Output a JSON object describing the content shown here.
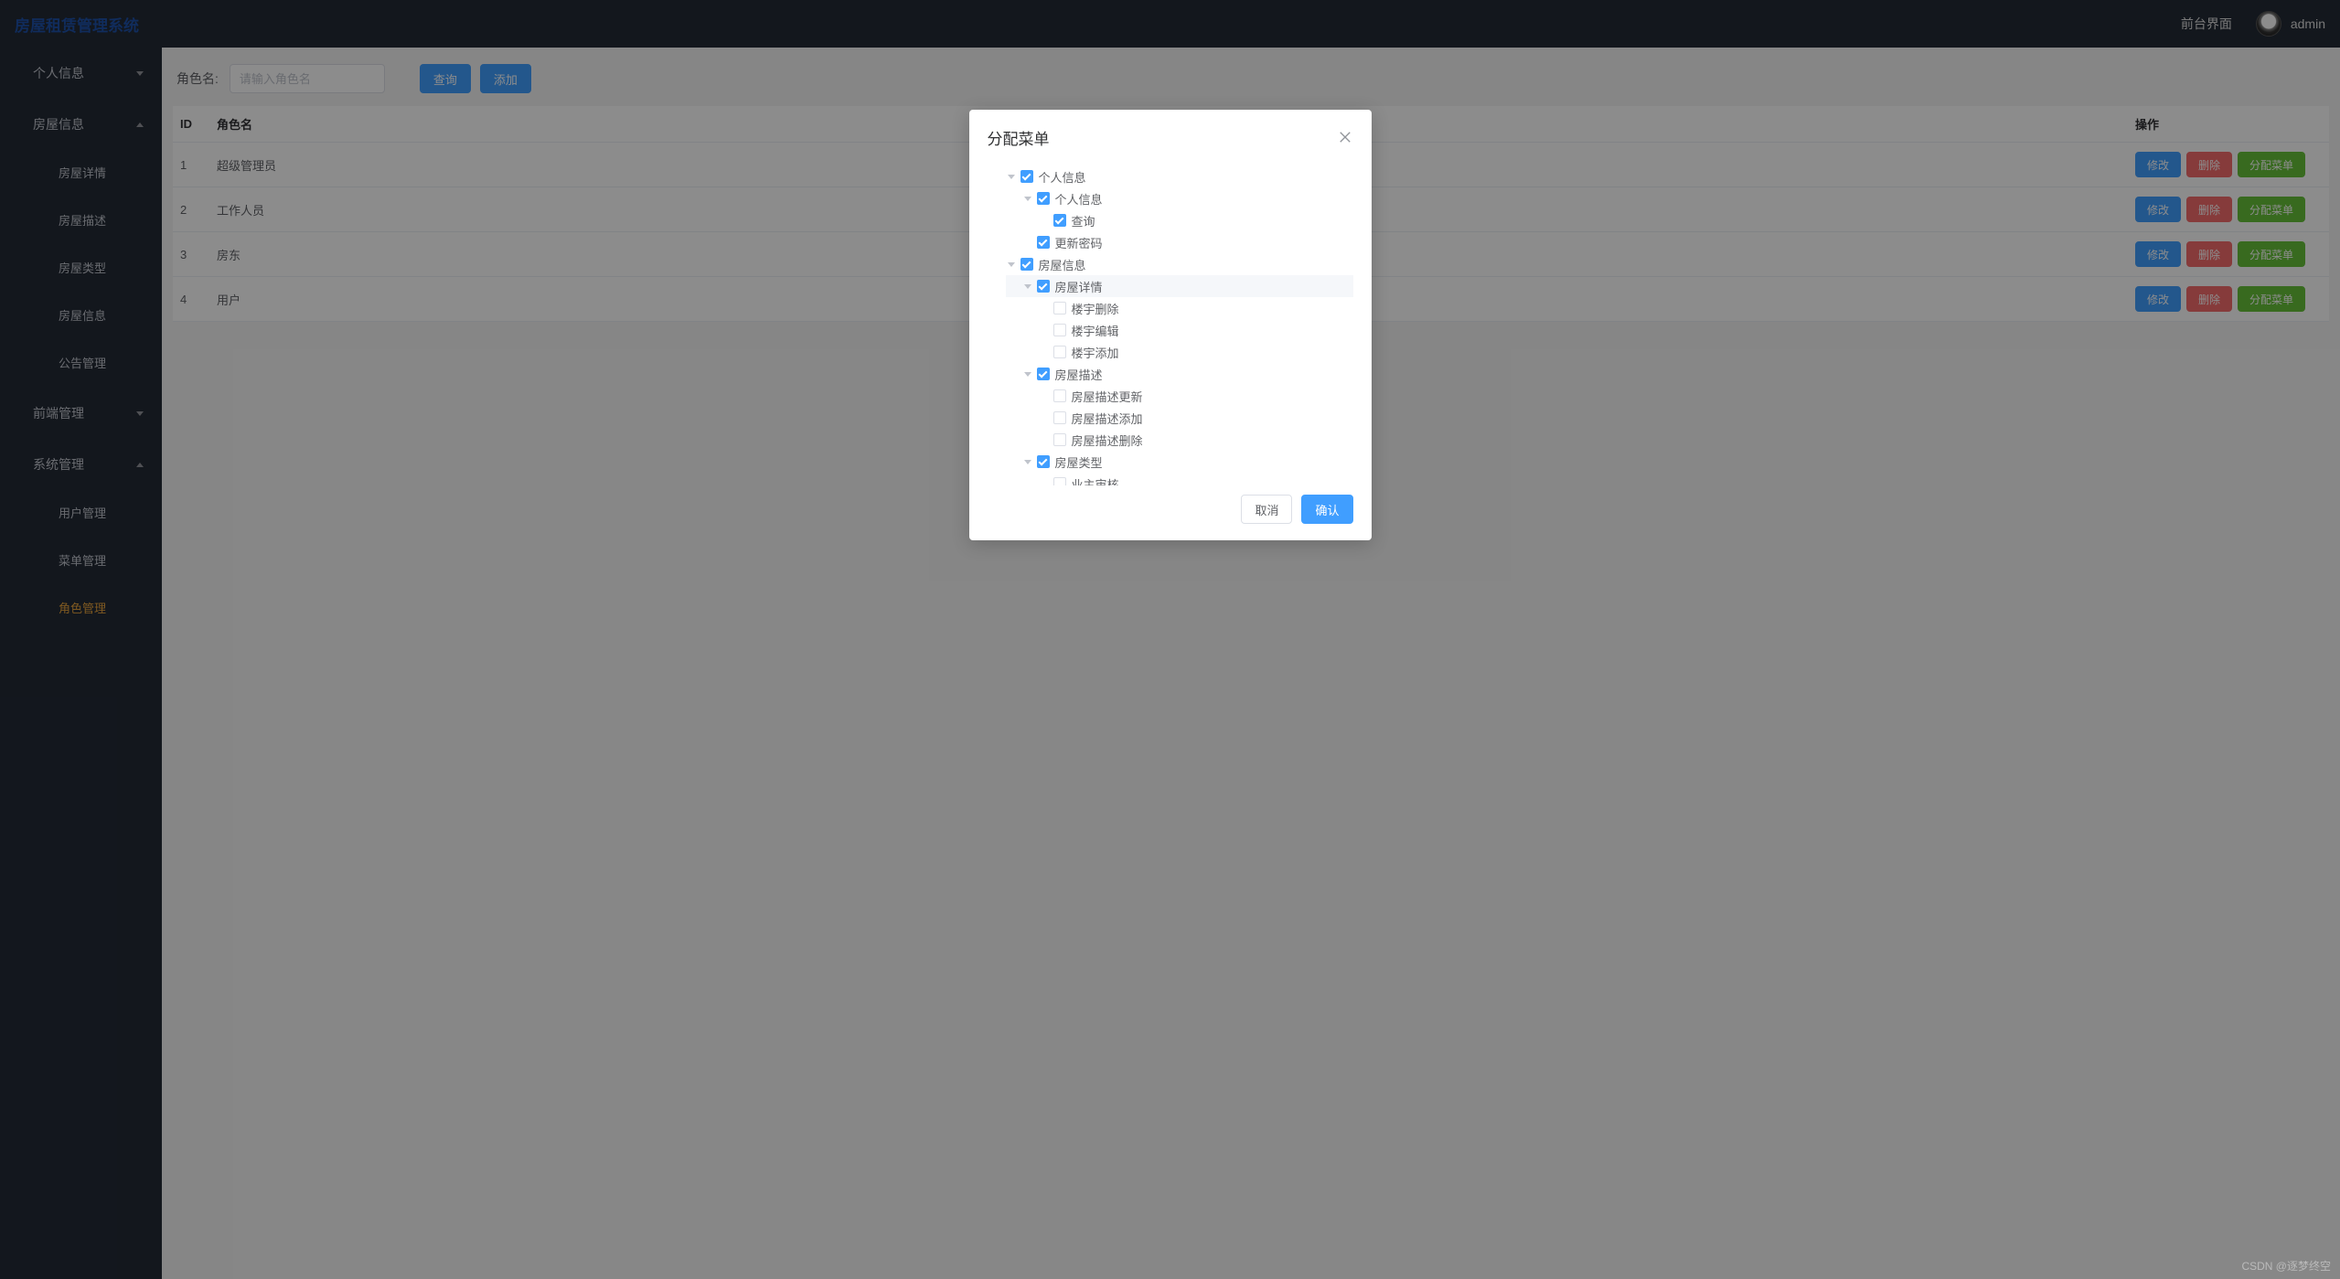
{
  "header": {
    "logo": "房屋租赁管理系统",
    "front_link": "前台界面",
    "username": "admin"
  },
  "sidebar": [
    {
      "label": "个人信息",
      "level": 0,
      "arrow": "down",
      "active": false
    },
    {
      "label": "房屋信息",
      "level": 0,
      "arrow": "up",
      "active": false
    },
    {
      "label": "房屋详情",
      "level": 1,
      "arrow": null,
      "active": false
    },
    {
      "label": "房屋描述",
      "level": 1,
      "arrow": null,
      "active": false
    },
    {
      "label": "房屋类型",
      "level": 1,
      "arrow": null,
      "active": false
    },
    {
      "label": "房屋信息",
      "level": 1,
      "arrow": null,
      "active": false
    },
    {
      "label": "公告管理",
      "level": 1,
      "arrow": null,
      "active": false
    },
    {
      "label": "前端管理",
      "level": 0,
      "arrow": "down",
      "active": false
    },
    {
      "label": "系统管理",
      "level": 0,
      "arrow": "up",
      "active": false
    },
    {
      "label": "用户管理",
      "level": 1,
      "arrow": null,
      "active": false
    },
    {
      "label": "菜单管理",
      "level": 1,
      "arrow": null,
      "active": false
    },
    {
      "label": "角色管理",
      "level": 1,
      "arrow": null,
      "active": true
    }
  ],
  "toolbar": {
    "search_label": "角色名:",
    "search_placeholder": "请输入角色名",
    "query_btn": "查询",
    "add_btn": "添加"
  },
  "table": {
    "headers": {
      "id": "ID",
      "name": "角色名",
      "ops": "操作"
    },
    "rows": [
      {
        "id": "1",
        "name": "超级管理员"
      },
      {
        "id": "2",
        "name": "工作人员"
      },
      {
        "id": "3",
        "name": "房东"
      },
      {
        "id": "4",
        "name": "用户"
      }
    ],
    "ops": {
      "edit": "修改",
      "delete": "删除",
      "assign": "分配菜单"
    }
  },
  "dialog": {
    "title": "分配菜单",
    "cancel": "取消",
    "confirm": "确认",
    "tree": [
      {
        "depth": 0,
        "expand": "down",
        "checked": true,
        "label": "个人信息",
        "hover": false
      },
      {
        "depth": 1,
        "expand": "down",
        "checked": true,
        "label": "个人信息",
        "hover": false
      },
      {
        "depth": 2,
        "expand": null,
        "checked": true,
        "label": "查询",
        "hover": false
      },
      {
        "depth": 1,
        "expand": null,
        "checked": true,
        "label": "更新密码",
        "hover": false
      },
      {
        "depth": 0,
        "expand": "down",
        "checked": true,
        "label": "房屋信息",
        "hover": false
      },
      {
        "depth": 1,
        "expand": "down",
        "checked": true,
        "label": "房屋详情",
        "hover": true
      },
      {
        "depth": 2,
        "expand": null,
        "checked": false,
        "label": "楼宇删除",
        "hover": false
      },
      {
        "depth": 2,
        "expand": null,
        "checked": false,
        "label": "楼宇编辑",
        "hover": false
      },
      {
        "depth": 2,
        "expand": null,
        "checked": false,
        "label": "楼宇添加",
        "hover": false
      },
      {
        "depth": 1,
        "expand": "down",
        "checked": true,
        "label": "房屋描述",
        "hover": false
      },
      {
        "depth": 2,
        "expand": null,
        "checked": false,
        "label": "房屋描述更新",
        "hover": false
      },
      {
        "depth": 2,
        "expand": null,
        "checked": false,
        "label": "房屋描述添加",
        "hover": false
      },
      {
        "depth": 2,
        "expand": null,
        "checked": false,
        "label": "房屋描述删除",
        "hover": false
      },
      {
        "depth": 1,
        "expand": "down",
        "checked": true,
        "label": "房屋类型",
        "hover": false
      },
      {
        "depth": 2,
        "expand": null,
        "checked": false,
        "label": "业主审核",
        "hover": false
      }
    ]
  },
  "watermark": "CSDN @逐梦终空"
}
